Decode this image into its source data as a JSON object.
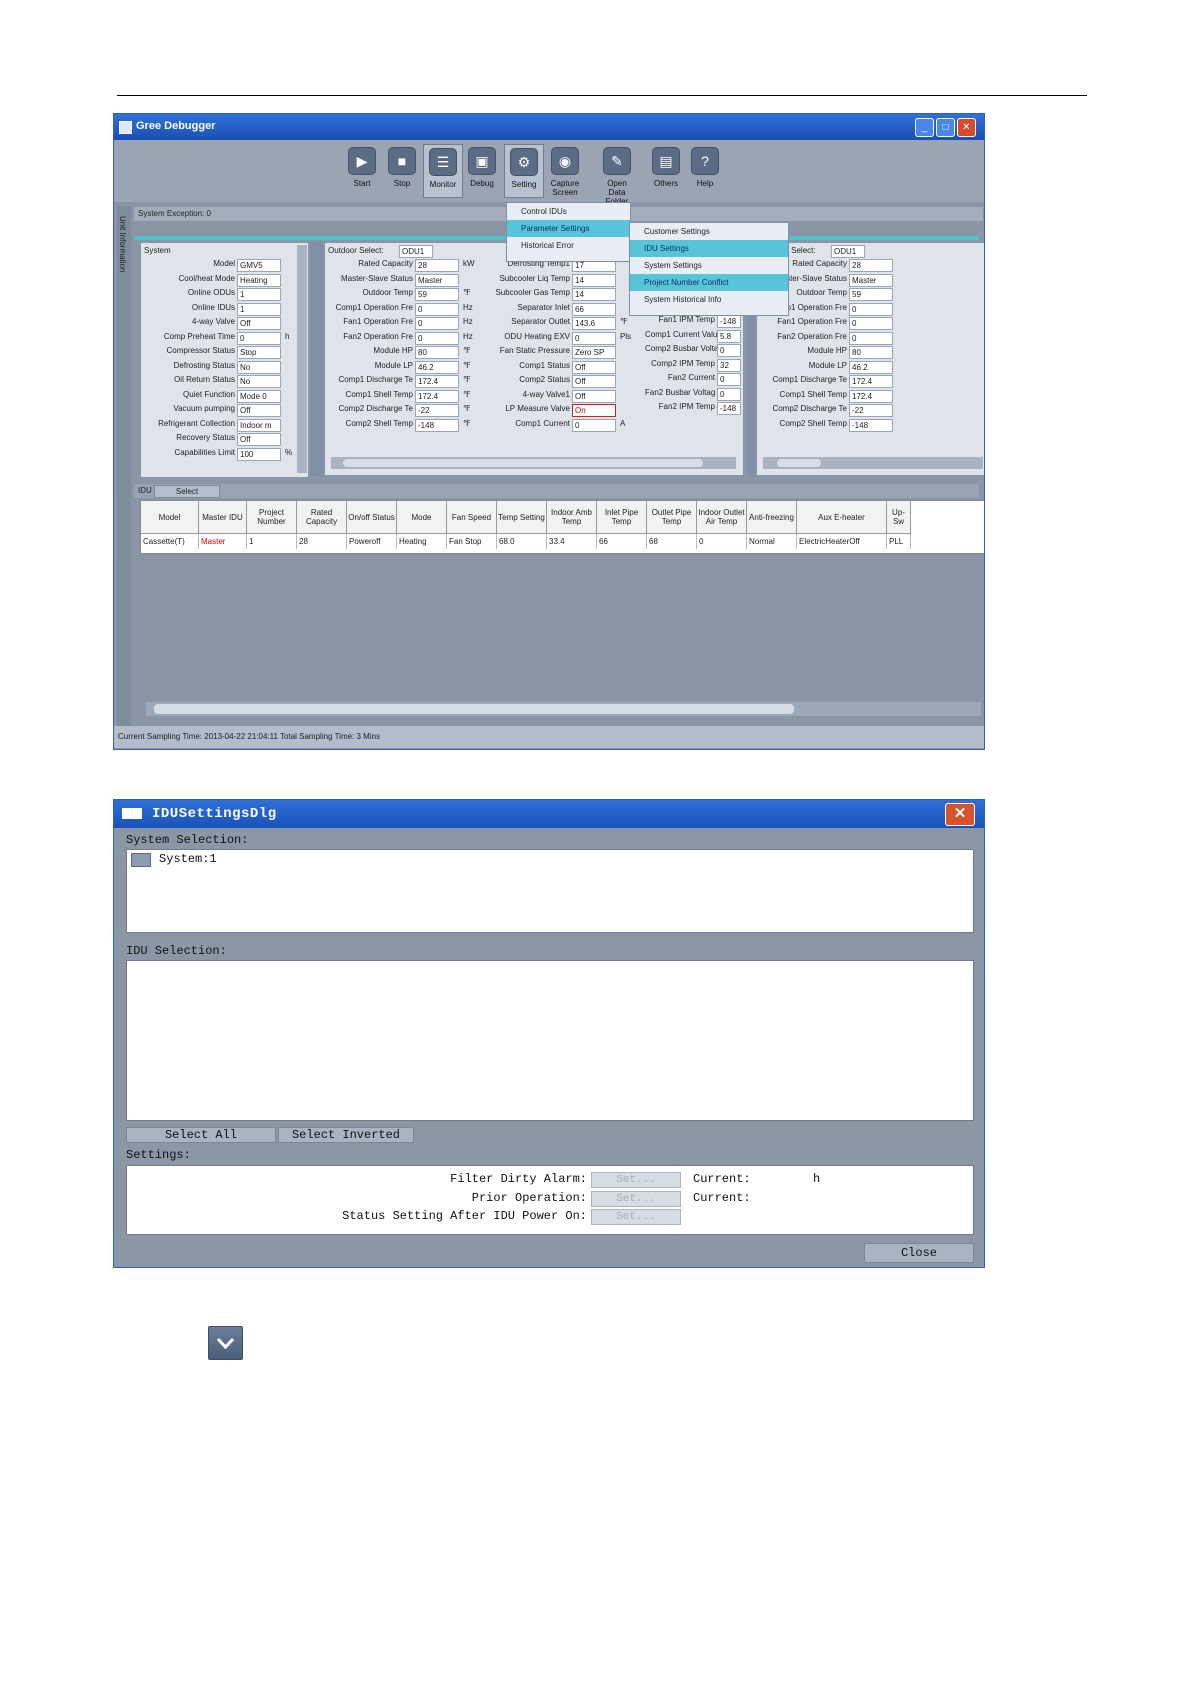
{
  "debugger": {
    "title": "Gree Debugger",
    "toolbar": [
      "Start",
      "Stop",
      "Monitor",
      "Debug",
      "Setting",
      "Capture Screen",
      "Open Data Folder",
      "Others",
      "Help"
    ],
    "system_exception": "System Exception: 0",
    "left_tab": "Unit Information",
    "system_panel": {
      "header": "System",
      "rows": [
        {
          "label": "Model",
          "value": "GMV5"
        },
        {
          "label": "Cool/heat Mode",
          "value": "Heating"
        },
        {
          "label": "Online ODUs",
          "value": "1"
        },
        {
          "label": "Online IDUs",
          "value": "1"
        },
        {
          "label": "4-way Valve",
          "value": "Off"
        },
        {
          "label": "Comp Preheat Time",
          "value": "0",
          "unit": "h"
        },
        {
          "label": "Compressor Status",
          "value": "Stop"
        },
        {
          "label": "Defrosting Status",
          "value": "No"
        },
        {
          "label": "Oil Return Status",
          "value": "No"
        },
        {
          "label": "Quiet Function",
          "value": "Mode 0"
        },
        {
          "label": "Vacuum pumping",
          "value": "Off"
        },
        {
          "label": "Refrigerant Collection",
          "value": "Indoor m"
        },
        {
          "label": "Recovery Status",
          "value": "Off"
        },
        {
          "label": "Capabilities Limit",
          "value": "100",
          "unit": "%"
        }
      ]
    },
    "outdoor": {
      "select_label": "Outdoor Select:",
      "select_value": "ODU1",
      "col1": [
        {
          "label": "Rated Capacity",
          "value": "28",
          "unit": "kW"
        },
        {
          "label": "Master-Slave Status",
          "value": "Master"
        },
        {
          "label": "Outdoor Temp",
          "value": "59",
          "unit": "℉"
        },
        {
          "label": "Comp1 Operation Fre",
          "value": "0",
          "unit": "Hz"
        },
        {
          "label": "Fan1 Operation Fre",
          "value": "0",
          "unit": "Hz"
        },
        {
          "label": "Fan2 Operation Fre",
          "value": "0",
          "unit": "Hz"
        },
        {
          "label": "Module HP",
          "value": "80",
          "unit": "℉"
        },
        {
          "label": "Module LP",
          "value": "46.2",
          "unit": "℉"
        },
        {
          "label": "Comp1 Discharge Te",
          "value": "172.4",
          "unit": "℉"
        },
        {
          "label": "Comp1 Shell Temp",
          "value": "172.4",
          "unit": "℉"
        },
        {
          "label": "Comp2 Discharge Te",
          "value": "-22",
          "unit": "℉"
        },
        {
          "label": "Comp2 Shell Temp",
          "value": "-148",
          "unit": "℉"
        }
      ],
      "col2": [
        {
          "label": "Defrosting Temp1",
          "value": "17"
        },
        {
          "label": "Subcooler Liq Temp",
          "value": "14"
        },
        {
          "label": "Subcooler Gas Temp",
          "value": "14"
        },
        {
          "label": "Separator Inlet",
          "value": "66"
        },
        {
          "label": "Separator Outlet",
          "value": "143.6",
          "unit": "℉"
        },
        {
          "label": "ODU Heating EXV",
          "value": "0",
          "unit": "Pls"
        },
        {
          "label": "Fan Static Pressure",
          "value": "Zero SP"
        },
        {
          "label": "Comp1 Status",
          "value": "Off"
        },
        {
          "label": "Comp2 Status",
          "value": "Off"
        },
        {
          "label": "4-way Valve1",
          "value": "Off"
        },
        {
          "label": "LP Measure Valve",
          "value": "On",
          "red": true
        },
        {
          "label": "Comp1 Current",
          "value": "0",
          "unit": "A"
        }
      ],
      "col3": [
        {
          "label": "Fan1 IPM Temp",
          "value": "-148"
        },
        {
          "label": "Comp1 Current Valu",
          "value": "5.8"
        },
        {
          "label": "Comp2 Busbar Volta",
          "value": "0"
        },
        {
          "label": "Comp2 IPM Temp",
          "value": "32"
        },
        {
          "label": "Fan2 Current",
          "value": "0"
        },
        {
          "label": "Fan2 Busbar Voltag",
          "value": "0"
        },
        {
          "label": "Fan2 IPM Temp",
          "value": "-148"
        }
      ]
    },
    "outdoor_right": {
      "select_label": "Outdoor Select:",
      "select_value": "ODU1",
      "rows": [
        {
          "label": "Rated Capacity",
          "value": "28"
        },
        {
          "label": "Master-Slave Status",
          "value": "Master"
        },
        {
          "label": "Outdoor Temp",
          "value": "59"
        },
        {
          "label": "Comp1 Operation Fre",
          "value": "0"
        },
        {
          "label": "Fan1 Operation Fre",
          "value": "0"
        },
        {
          "label": "Fan2 Operation Fre",
          "value": "0"
        },
        {
          "label": "Module HP",
          "value": "80"
        },
        {
          "label": "Module LP",
          "value": "46.2"
        },
        {
          "label": "Comp1 Discharge Te",
          "value": "172.4"
        },
        {
          "label": "Comp1 Shell Temp",
          "value": "172.4"
        },
        {
          "label": "Comp2 Discharge Te",
          "value": "-22"
        },
        {
          "label": "Comp2 Shell Temp",
          "value": "-148"
        }
      ]
    },
    "setting_menu": [
      "Control IDUs",
      "Parameter Settings",
      "Historical Error"
    ],
    "param_submenu": [
      "Customer Settings",
      "IDU Settings",
      "System Settings",
      "Project Number Conflict",
      "System Historical Info"
    ],
    "idu_bar_label": "IDU",
    "idu_bar_select": "Select",
    "idu_table": {
      "headers": [
        "Model",
        "Master IDU",
        "Project Number",
        "Rated Capacity",
        "On/off Status",
        "Mode",
        "Fan Speed",
        "Temp Setting",
        "Indoor Amb Temp",
        "Inlet Pipe Temp",
        "Outlet Pipe Temp",
        "Indoor Outlet Air Temp",
        "Anti-freezing",
        "Aux E-heater",
        "Up-Sw"
      ],
      "row": [
        "Cassette(T)",
        "Master",
        "1",
        "28",
        "Poweroff",
        "Heating",
        "Fan Stop",
        "68.0",
        "33.4",
        "66",
        "68",
        "0",
        "Normal",
        "ElectricHeaterOff",
        "PLL"
      ]
    },
    "status_bar": "Current Sampling Time: 2013-04-22 21:04:11  Total Sampling Time: 3 Mins"
  },
  "dialog": {
    "title": "IDUSettingsDlg",
    "system_selection_label": "System Selection:",
    "system_item": "System:1",
    "idu_selection_label": "IDU Selection:",
    "select_all": "Select All",
    "select_inverted": "Select Inverted",
    "settings_label": "Settings:",
    "settings_rows": [
      {
        "label": "Filter Dirty Alarm:",
        "button": "Set...",
        "current_label": "Current:",
        "current_value": "h"
      },
      {
        "label": "Prior Operation:",
        "button": "Set...",
        "current_label": "Current:",
        "current_value": ""
      },
      {
        "label": "Status Setting After IDU Power On:",
        "button": "Set...",
        "current_label": "",
        "current_value": ""
      }
    ],
    "close": "Close"
  },
  "icons": {
    "dropdown": "chevron-down-icon"
  }
}
